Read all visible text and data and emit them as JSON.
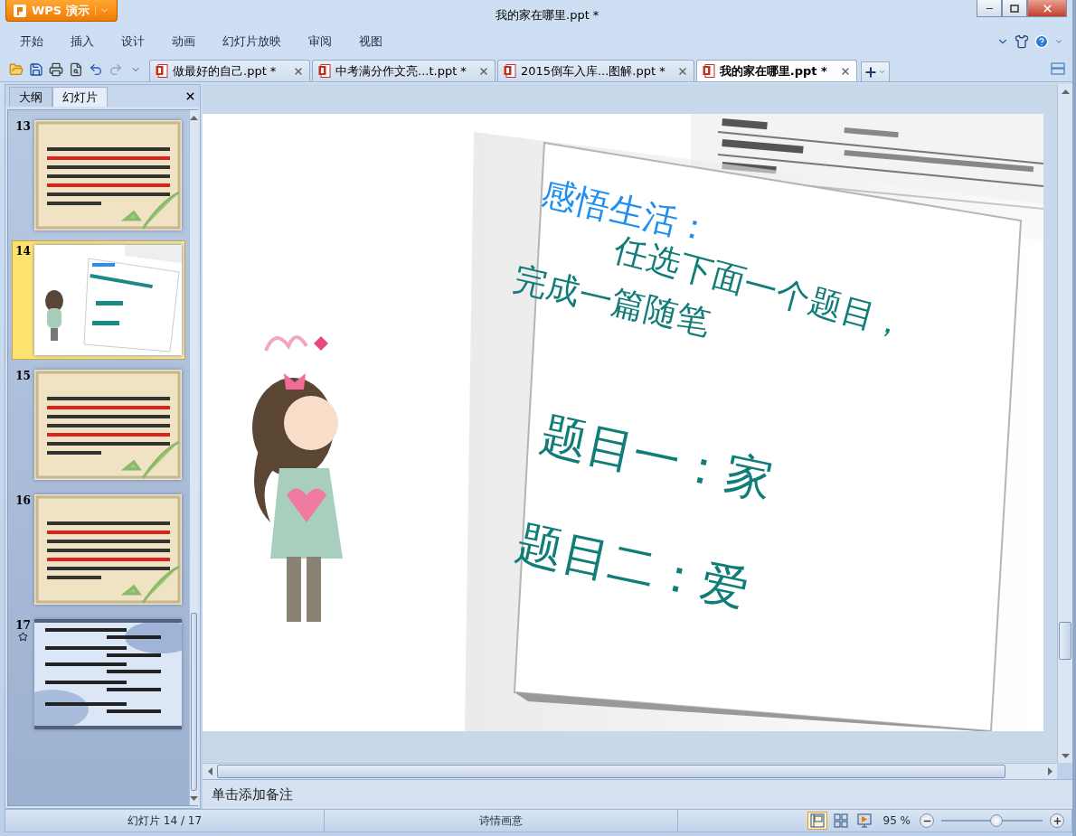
{
  "app_button": {
    "label": "WPS 演示"
  },
  "window": {
    "title": "我的家在哪里.ppt *"
  },
  "menu": [
    "开始",
    "插入",
    "设计",
    "动画",
    "幻灯片放映",
    "审阅",
    "视图"
  ],
  "doc_tabs": [
    {
      "label": "做最好的自己.ppt *",
      "selected": false
    },
    {
      "label": "中考满分作文亮...t.ppt *",
      "selected": false
    },
    {
      "label": "2015倒车入库...图解.ppt *",
      "selected": false
    },
    {
      "label": "我的家在哪里.ppt *",
      "selected": true
    }
  ],
  "panel": {
    "tabs": [
      {
        "label": "大纲",
        "selected": false
      },
      {
        "label": "幻灯片",
        "selected": true
      }
    ]
  },
  "slides": [
    {
      "number": "13",
      "kind": "parchment",
      "selected": false,
      "animation": false
    },
    {
      "number": "14",
      "kind": "current",
      "selected": true,
      "animation": false
    },
    {
      "number": "15",
      "kind": "parchment",
      "selected": false,
      "animation": false
    },
    {
      "number": "16",
      "kind": "parchment",
      "selected": false,
      "animation": false
    },
    {
      "number": "17",
      "kind": "ink",
      "selected": false,
      "animation": true
    }
  ],
  "slide": {
    "heading": "感悟生活：",
    "lines": [
      "任选下面一个题目，",
      "完成一篇随笔"
    ],
    "topics": [
      "题目一：家",
      "题目二：爱"
    ]
  },
  "notes": {
    "placeholder": "单击添加备注"
  },
  "status": {
    "slide_count": "幻灯片 14 / 17",
    "theme": "诗情画意",
    "zoom": "95 %",
    "views": [
      {
        "kind": "normal",
        "selected": true
      },
      {
        "kind": "sorter",
        "selected": false
      },
      {
        "kind": "show",
        "selected": false
      }
    ],
    "zoom_slider": {
      "level": 0.55
    }
  }
}
